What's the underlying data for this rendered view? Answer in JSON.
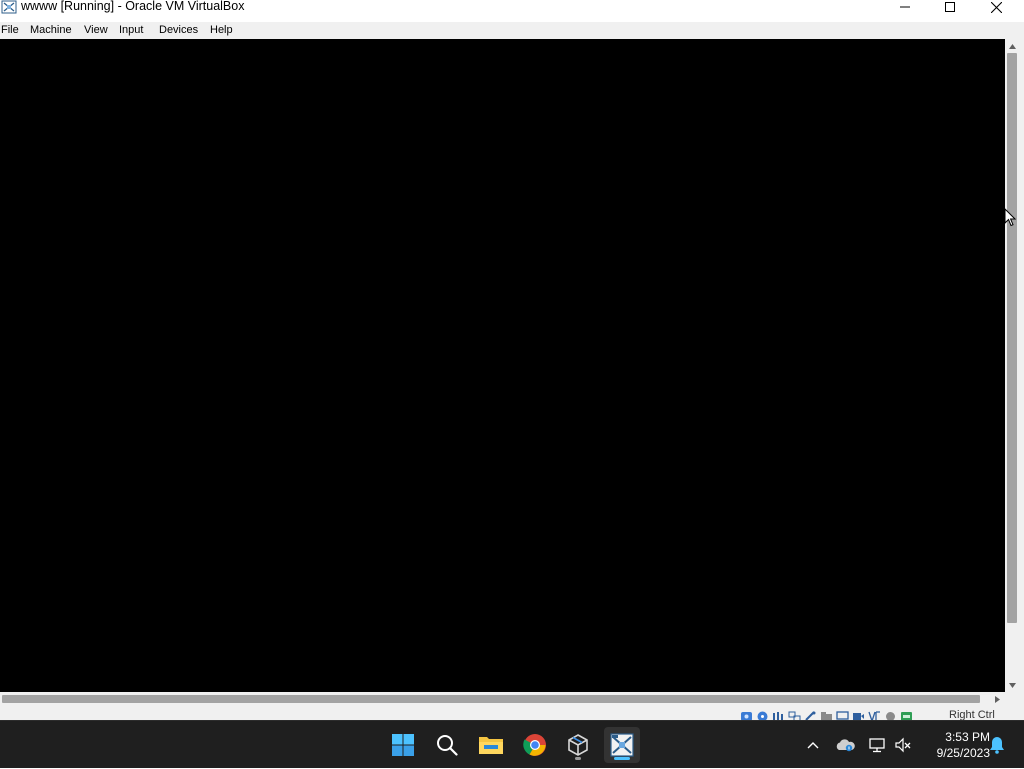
{
  "window": {
    "title": "wwww [Running] - Oracle VM VirtualBox",
    "controls": [
      "minimize-icon",
      "maximize-icon",
      "close-icon"
    ]
  },
  "menu": {
    "file": "File",
    "machine": "Machine",
    "view": "View",
    "input": "Input",
    "devices": "Devices",
    "help": "Help"
  },
  "statusbar": {
    "icons": [
      "hard-disk-icon",
      "optical-drive-icon",
      "audio-icon",
      "network-icon",
      "usb-icon",
      "shared-folders-icon",
      "display-icon",
      "recording-icon",
      "cpu-icon",
      "mouse-integration-icon",
      "keyboard-icon"
    ],
    "host_key": "Right Ctrl"
  },
  "taskbar": {
    "apps": [
      "start-icon",
      "search-icon",
      "file-explorer-icon",
      "chrome-icon",
      "virtualbox-manager-icon",
      "virtualbox-vm-icon"
    ],
    "time": "3:53 PM",
    "date": "9/25/2023"
  },
  "colors": {
    "vm_background": "#000000",
    "taskbar": "#1f1f1f",
    "accent": "#4cc2ff"
  }
}
